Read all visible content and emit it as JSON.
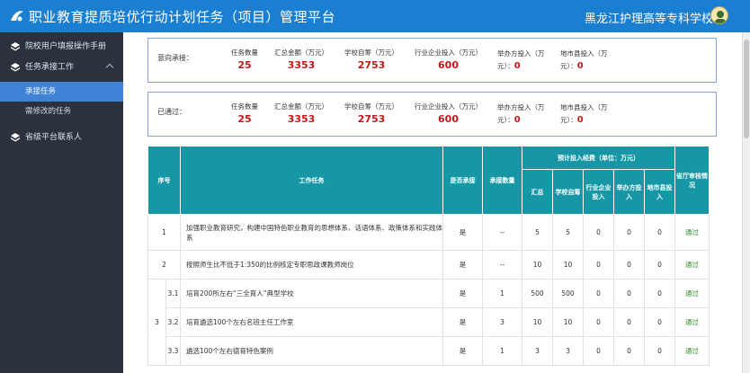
{
  "header": {
    "title": "职业教育提质培优行动计划任务（项目）管理平台",
    "school": "黑龙江护理高等专科学校"
  },
  "sidebar": {
    "items": [
      {
        "label": "院校用户填报操作手册"
      },
      {
        "label": "任务承接工作",
        "children": [
          "承接任务",
          "需修改的任务"
        ],
        "active_child": "承接任务"
      },
      {
        "label": "省级平台联系人"
      }
    ]
  },
  "summary_intent": {
    "label": "意向承接：",
    "task_count_label": "任务数量",
    "task_count": "25",
    "total_label": "汇总金额（万元）",
    "total": "3353",
    "school_label": "学校自筹（万元）",
    "school": "2753",
    "industry_label": "行业企业投入（万元）",
    "industry": "600",
    "sponsor_label": "举办方投入（万元）：",
    "sponsor": "0",
    "local_label": "地市县投入（万元）：",
    "local": "0"
  },
  "summary_passed": {
    "label": "已通过：",
    "task_count_label": "任务数量",
    "task_count": "25",
    "total_label": "汇总金额（万元）",
    "total": "3353",
    "school_label": "学校自筹（万元）",
    "school": "2753",
    "industry_label": "行业企业投入（万元）",
    "industry": "600",
    "sponsor_label": "举办方投入（万元）：",
    "sponsor": "0",
    "local_label": "地市县投入（万元）：",
    "local": "0"
  },
  "table": {
    "headers": {
      "no": "序号",
      "task": "工作任务",
      "accept": "是否承接",
      "count": "承接数量",
      "budget": "预计投入经费（单位：万元）",
      "total": "汇总",
      "school": "学校自筹",
      "industry": "行业企业投入",
      "sponsor": "举办方投入",
      "local": "地市县投入",
      "review": "省厅审核情况"
    },
    "rows": [
      {
        "no": "1",
        "sub": "",
        "task": "加强职业教育研究，构建中国特色职业教育的思想体系、话语体系、政策体系和实践体系",
        "accept": "是",
        "count": "--",
        "total": "5",
        "school": "5",
        "industry": "0",
        "sponsor": "0",
        "local": "0",
        "review": "通过"
      },
      {
        "no": "2",
        "sub": "",
        "task": "按照师生比不低于1:350的比例核定专职思政课教师岗位",
        "accept": "是",
        "count": "--",
        "total": "10",
        "school": "10",
        "industry": "0",
        "sponsor": "0",
        "local": "0",
        "review": "通过"
      },
      {
        "no": "3",
        "sub": "3.1",
        "task": "培育200所左右“三全育人”典型学校",
        "accept": "是",
        "count": "1",
        "total": "500",
        "school": "500",
        "industry": "0",
        "sponsor": "0",
        "local": "0",
        "review": "通过"
      },
      {
        "no": "",
        "sub": "3.2",
        "task": "培育遴选100个左右名班主任工作室",
        "accept": "是",
        "count": "3",
        "total": "10",
        "school": "10",
        "industry": "0",
        "sponsor": "0",
        "local": "0",
        "review": "通过"
      },
      {
        "no": "",
        "sub": "3.3",
        "task": "遴选100个左右德育特色案例",
        "accept": "是",
        "count": "1",
        "total": "3",
        "school": "3",
        "industry": "0",
        "sponsor": "0",
        "local": "0",
        "review": "通过"
      }
    ]
  }
}
